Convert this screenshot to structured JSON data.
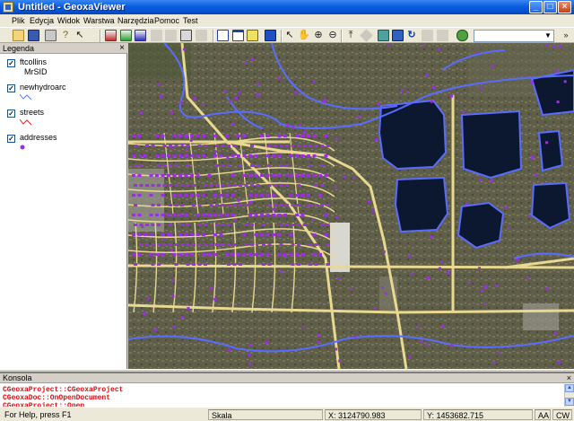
{
  "window": {
    "title": "Untitled - GeoxaViewer"
  },
  "menu": {
    "items": [
      "Plik",
      "Edycja",
      "Widok",
      "Warstwa",
      "Narzędzia",
      "Pomoc",
      "Test"
    ]
  },
  "toolbar": {
    "combo_value": ""
  },
  "legend": {
    "title": "Legenda",
    "close_glyph": "×",
    "layers": [
      {
        "name": "ftcollins",
        "sub": "MrSID",
        "checked": true
      },
      {
        "name": "newhydroarc",
        "sub": "",
        "checked": true,
        "color": "#5a78ff"
      },
      {
        "name": "streets",
        "sub": "",
        "checked": true,
        "color": "#e02020"
      },
      {
        "name": "addresses",
        "sub": "",
        "checked": true,
        "color": "#9a30e0"
      }
    ]
  },
  "console": {
    "title": "Konsola",
    "close_glyph": "×",
    "lines": [
      "CGeoxaProject::CGeoxaProject",
      "CGeoxaDoc::OnOpenDocument",
      "CGeoxaProject::Open"
    ]
  },
  "status": {
    "help": "For Help, press F1",
    "scale": "Skala",
    "x": "X: 3124790.983",
    "y": "Y: 1453682.715",
    "ind1": "AA",
    "ind2": "CW"
  },
  "colors": {
    "hydro": "#5a6cff",
    "streets": "#e8d890",
    "addresses": "#9a30e0",
    "water": "#0c1830"
  }
}
